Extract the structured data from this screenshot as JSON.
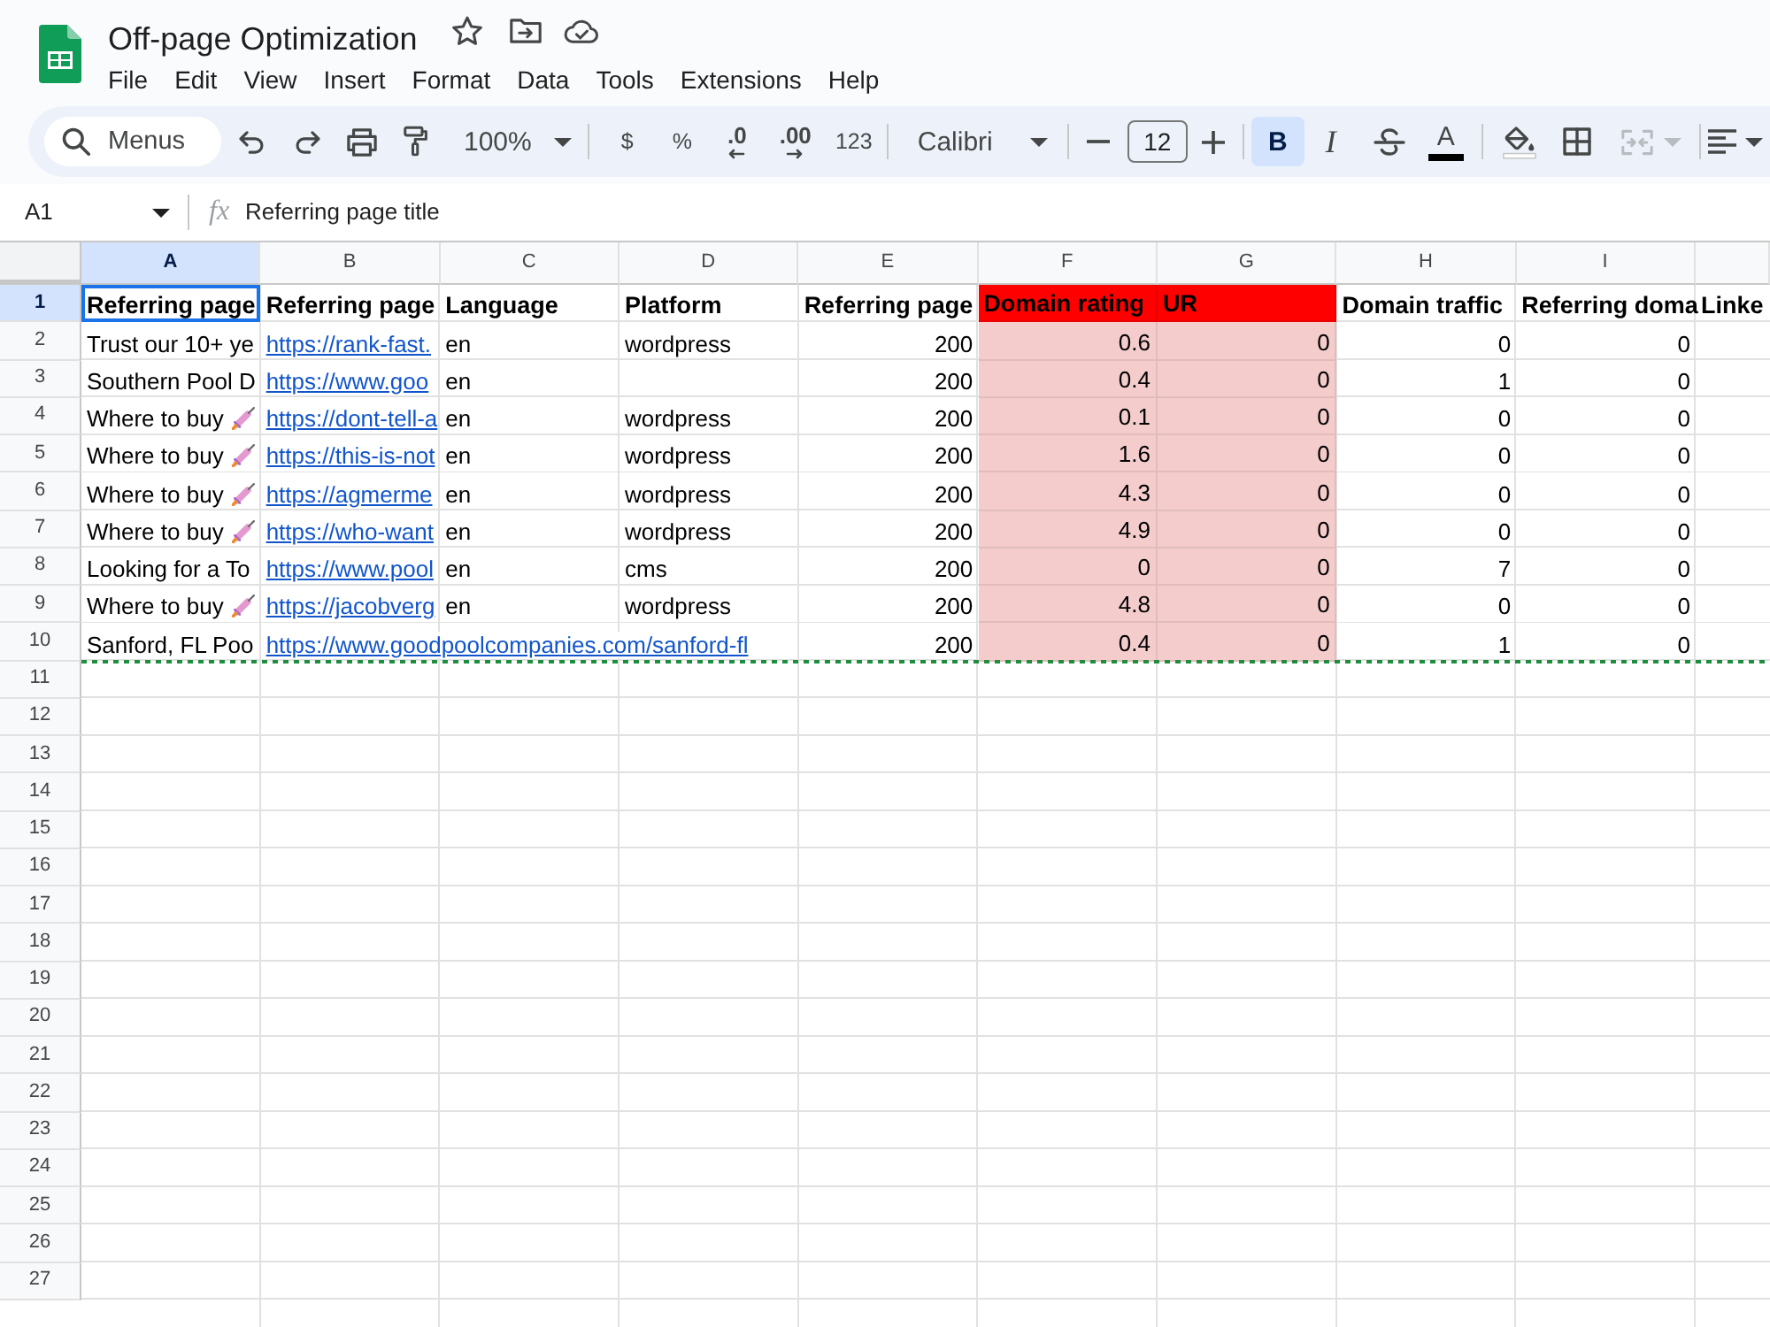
{
  "document": {
    "title": "Off-page Optimization"
  },
  "menu": [
    "File",
    "Edit",
    "View",
    "Insert",
    "Format",
    "Data",
    "Tools",
    "Extensions",
    "Help"
  ],
  "toolbar": {
    "search": {
      "placeholder": "Menus"
    },
    "zoom": "100%",
    "currency": "$",
    "percent": "%",
    "decrease_decimal": ".0",
    "increase_decimal": ".00",
    "number_format": "123",
    "font": "Calibri",
    "font_size": "12",
    "bold": {
      "label": "B",
      "selected": true
    },
    "italic": {
      "label": "I",
      "selected": false
    },
    "text_color": {
      "label": "A"
    },
    "merge": {
      "disabled": true
    }
  },
  "formula_bar": {
    "cell_ref": "A1",
    "fx": "fx",
    "value": "Referring page title"
  },
  "sheet": {
    "columns": [
      {
        "letter": "A",
        "selected": true
      },
      {
        "letter": "B",
        "selected": false
      },
      {
        "letter": "C",
        "selected": false
      },
      {
        "letter": "D",
        "selected": false
      },
      {
        "letter": "E",
        "selected": false
      },
      {
        "letter": "F",
        "selected": false
      },
      {
        "letter": "G",
        "selected": false
      },
      {
        "letter": "H",
        "selected": false
      },
      {
        "letter": "I",
        "selected": false
      }
    ],
    "rows": [
      {
        "number": "1",
        "selected": true,
        "dashed_bottom": false,
        "cells": [
          {
            "kind": "heading",
            "text": "Referring page"
          },
          {
            "kind": "heading",
            "text": "Referring page"
          },
          {
            "kind": "heading",
            "text": "Language"
          },
          {
            "kind": "heading",
            "text": "Platform"
          },
          {
            "kind": "heading",
            "text": "Referring page"
          },
          {
            "kind": "heading",
            "text": "Domain rating",
            "color": "#ff0000"
          },
          {
            "kind": "heading",
            "text": "UR",
            "color": "#ff0000"
          },
          {
            "kind": "heading",
            "text": "Domain traffic"
          },
          {
            "kind": "heading",
            "text": "Referring doma"
          },
          {
            "kind": "heading",
            "text": "Linke"
          }
        ]
      },
      {
        "number": "2",
        "selected": false,
        "dashed_bottom": false,
        "cells": [
          {
            "kind": "text",
            "text": "Trust our 10+ ye"
          },
          {
            "kind": "link",
            "text": "https://rank-fast."
          },
          {
            "kind": "text",
            "text": "en"
          },
          {
            "kind": "text",
            "text": "wordpress"
          },
          {
            "kind": "number",
            "text": "200"
          },
          {
            "kind": "number",
            "text": "0.6",
            "color": "#f4cccc"
          },
          {
            "kind": "number",
            "text": "0",
            "color": "#f4cccc"
          },
          {
            "kind": "number",
            "text": "0"
          },
          {
            "kind": "number",
            "text": "0"
          },
          null
        ]
      },
      {
        "number": "3",
        "selected": false,
        "dashed_bottom": false,
        "cells": [
          {
            "kind": "text",
            "text": "Southern Pool D"
          },
          {
            "kind": "link",
            "text": "https://www.goo"
          },
          {
            "kind": "text",
            "text": "en"
          },
          null,
          {
            "kind": "number",
            "text": "200"
          },
          {
            "kind": "number",
            "text": "0.4",
            "color": "#f4cccc"
          },
          {
            "kind": "number",
            "text": "0",
            "color": "#f4cccc"
          },
          {
            "kind": "number",
            "text": "1"
          },
          {
            "kind": "number",
            "text": "0"
          },
          null
        ]
      },
      {
        "number": "4",
        "selected": false,
        "dashed_bottom": false,
        "cells": [
          {
            "kind": "text_emoji",
            "text": "Where to buy"
          },
          {
            "kind": "link",
            "text": "https://dont-tell-a"
          },
          {
            "kind": "text",
            "text": "en"
          },
          {
            "kind": "text",
            "text": "wordpress"
          },
          {
            "kind": "number",
            "text": "200"
          },
          {
            "kind": "number",
            "text": "0.1",
            "color": "#f4cccc"
          },
          {
            "kind": "number",
            "text": "0",
            "color": "#f4cccc"
          },
          {
            "kind": "number",
            "text": "0"
          },
          {
            "kind": "number",
            "text": "0"
          },
          null
        ]
      },
      {
        "number": "5",
        "selected": false,
        "dashed_bottom": false,
        "cells": [
          {
            "kind": "text_emoji",
            "text": "Where to buy"
          },
          {
            "kind": "link",
            "text": "https://this-is-not"
          },
          {
            "kind": "text",
            "text": "en"
          },
          {
            "kind": "text",
            "text": "wordpress"
          },
          {
            "kind": "number",
            "text": "200"
          },
          {
            "kind": "number",
            "text": "1.6",
            "color": "#f4cccc"
          },
          {
            "kind": "number",
            "text": "0",
            "color": "#f4cccc"
          },
          {
            "kind": "number",
            "text": "0"
          },
          {
            "kind": "number",
            "text": "0"
          },
          null
        ]
      },
      {
        "number": "6",
        "selected": false,
        "dashed_bottom": false,
        "cells": [
          {
            "kind": "text_emoji",
            "text": "Where to buy"
          },
          {
            "kind": "link",
            "text": "https://agmerme"
          },
          {
            "kind": "text",
            "text": "en"
          },
          {
            "kind": "text",
            "text": "wordpress"
          },
          {
            "kind": "number",
            "text": "200"
          },
          {
            "kind": "number",
            "text": "4.3",
            "color": "#f4cccc"
          },
          {
            "kind": "number",
            "text": "0",
            "color": "#f4cccc"
          },
          {
            "kind": "number",
            "text": "0"
          },
          {
            "kind": "number",
            "text": "0"
          },
          null
        ]
      },
      {
        "number": "7",
        "selected": false,
        "dashed_bottom": false,
        "cells": [
          {
            "kind": "text_emoji",
            "text": "Where to buy"
          },
          {
            "kind": "link",
            "text": "https://who-want"
          },
          {
            "kind": "text",
            "text": "en"
          },
          {
            "kind": "text",
            "text": "wordpress"
          },
          {
            "kind": "number",
            "text": "200"
          },
          {
            "kind": "number",
            "text": "4.9",
            "color": "#f4cccc"
          },
          {
            "kind": "number",
            "text": "0",
            "color": "#f4cccc"
          },
          {
            "kind": "number",
            "text": "0"
          },
          {
            "kind": "number",
            "text": "0"
          },
          null
        ]
      },
      {
        "number": "8",
        "selected": false,
        "dashed_bottom": false,
        "cells": [
          {
            "kind": "text",
            "text": "Looking for a To"
          },
          {
            "kind": "link",
            "text": "https://www.pool"
          },
          {
            "kind": "text",
            "text": "en"
          },
          {
            "kind": "text",
            "text": "cms"
          },
          {
            "kind": "number",
            "text": "200"
          },
          {
            "kind": "number",
            "text": "0",
            "color": "#f4cccc"
          },
          {
            "kind": "number",
            "text": "0",
            "color": "#f4cccc"
          },
          {
            "kind": "number",
            "text": "7"
          },
          {
            "kind": "number",
            "text": "0"
          },
          null
        ]
      },
      {
        "number": "9",
        "selected": false,
        "dashed_bottom": false,
        "cells": [
          {
            "kind": "text_emoji",
            "text": "Where to buy"
          },
          {
            "kind": "link",
            "text": "https://jacobverg"
          },
          {
            "kind": "text",
            "text": "en"
          },
          {
            "kind": "text",
            "text": "wordpress"
          },
          {
            "kind": "number",
            "text": "200"
          },
          {
            "kind": "number",
            "text": "4.8",
            "color": "#f4cccc"
          },
          {
            "kind": "number",
            "text": "0",
            "color": "#f4cccc"
          },
          {
            "kind": "number",
            "text": "0"
          },
          {
            "kind": "number",
            "text": "0"
          },
          null
        ]
      },
      {
        "number": "10",
        "selected": false,
        "dashed_bottom": true,
        "cells": [
          {
            "kind": "text",
            "text": "Sanford, FL Poo"
          },
          {
            "kind": "link",
            "text": "https://www.goodpoolcompanies.com/sanford-fl"
          },
          null,
          null,
          {
            "kind": "number",
            "text": "200"
          },
          {
            "kind": "number",
            "text": "0.4",
            "color": "#f4cccc"
          },
          {
            "kind": "number",
            "text": "0",
            "color": "#f4cccc"
          },
          {
            "kind": "number",
            "text": "1"
          },
          {
            "kind": "number",
            "text": "0"
          },
          null
        ]
      },
      {
        "number": "11",
        "selected": false,
        "dashed_bottom": false
      },
      {
        "number": "12",
        "selected": false,
        "dashed_bottom": false
      },
      {
        "number": "13",
        "selected": false,
        "dashed_bottom": false
      },
      {
        "number": "14",
        "selected": false,
        "dashed_bottom": false
      },
      {
        "number": "15",
        "selected": false,
        "dashed_bottom": false
      },
      {
        "number": "16",
        "selected": false,
        "dashed_bottom": false
      },
      {
        "number": "17",
        "selected": false,
        "dashed_bottom": false
      },
      {
        "number": "18",
        "selected": false,
        "dashed_bottom": false
      },
      {
        "number": "19",
        "selected": false,
        "dashed_bottom": false
      },
      {
        "number": "20",
        "selected": false,
        "dashed_bottom": false
      },
      {
        "number": "21",
        "selected": false,
        "dashed_bottom": false
      },
      {
        "number": "22",
        "selected": false,
        "dashed_bottom": false
      },
      {
        "number": "23",
        "selected": false,
        "dashed_bottom": false
      },
      {
        "number": "24",
        "selected": false,
        "dashed_bottom": false
      },
      {
        "number": "25",
        "selected": false,
        "dashed_bottom": false
      },
      {
        "number": "26",
        "selected": false,
        "dashed_bottom": false
      },
      {
        "number": "27",
        "selected": false,
        "dashed_bottom": false
      }
    ]
  }
}
